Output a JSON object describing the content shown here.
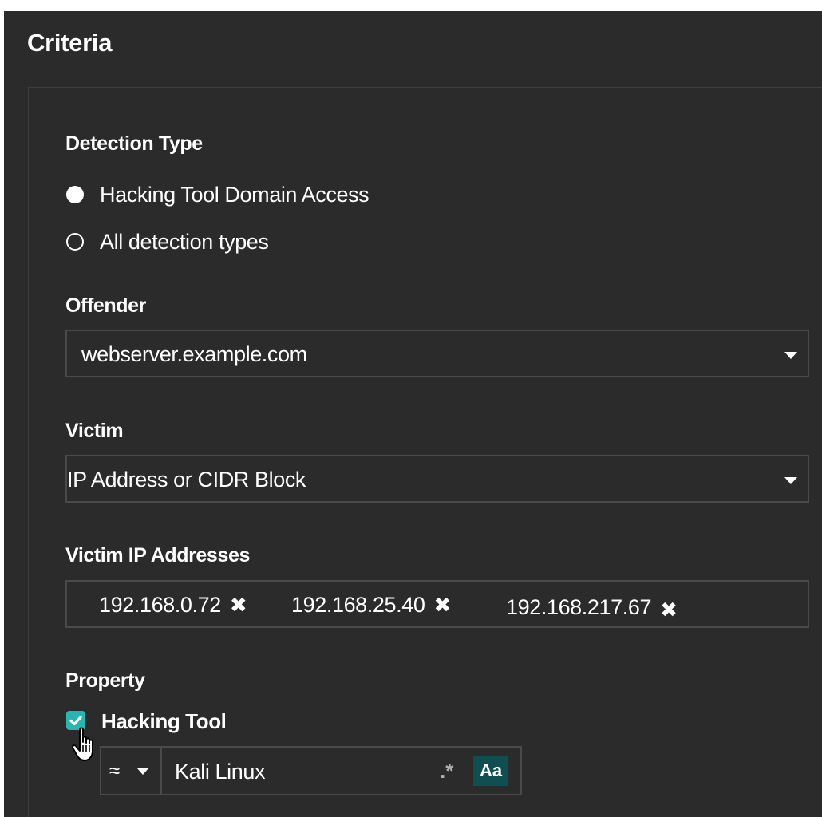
{
  "panel": {
    "title": "Criteria"
  },
  "detection_type": {
    "label": "Detection Type",
    "options": [
      {
        "label": "Hacking Tool Domain Access",
        "selected": true
      },
      {
        "label": "All detection types",
        "selected": false
      }
    ]
  },
  "offender": {
    "label": "Offender",
    "value": "webserver.example.com"
  },
  "victim": {
    "label": "Victim",
    "value": "IP Address or CIDR Block"
  },
  "victim_ips": {
    "label": "Victim IP Addresses",
    "tags": [
      "192.168.0.72",
      "192.168.25.40",
      "192.168.217.67"
    ],
    "remove_glyph": "✖"
  },
  "property": {
    "label": "Property",
    "checkbox_label": "Hacking Tool",
    "checked": true,
    "operator": "≈",
    "value": "Kali Linux",
    "regex_toggle": ".*",
    "case_toggle": "Aa"
  },
  "colors": {
    "panel_bg": "#2b2b2b",
    "accent": "#26b5b0",
    "case_toggle_bg": "#0f4f52",
    "border": "#4a4a4a"
  },
  "icons": [
    "radio-selected-icon",
    "radio-unselected-icon",
    "chevron-down-icon",
    "remove-tag-icon",
    "checkbox-checked-icon",
    "pointer-cursor-icon",
    "regex-icon",
    "match-case-icon"
  ]
}
